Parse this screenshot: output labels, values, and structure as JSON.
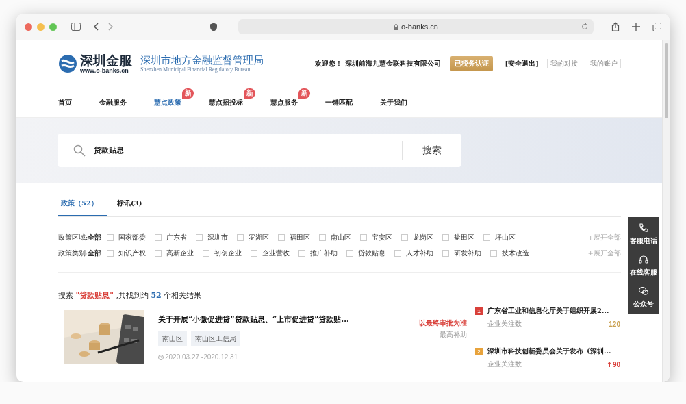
{
  "browser": {
    "url": "o-banks.cn"
  },
  "header": {
    "logo": {
      "name": "深圳金服",
      "site": "www.o-banks.cn"
    },
    "regulator": {
      "name": "深圳市地方金融监督管理局",
      "english": "Shenzhen Municipal Financial Regulatory Bureau"
    },
    "welcome": "欢迎您！ 深圳前海九慧金联科技有限公司",
    "certified": "已税务认证",
    "links": [
      "[安全退出]",
      "我的对接",
      "我的账户"
    ]
  },
  "nav": [
    {
      "label": "首页",
      "selected": false
    },
    {
      "label": "金融服务",
      "selected": false
    },
    {
      "label": "慧点政策",
      "selected": true,
      "badge": "新"
    },
    {
      "label": "慧点招投标",
      "selected": false,
      "badge": "新"
    },
    {
      "label": "慧点服务",
      "selected": false,
      "badge": "新"
    },
    {
      "label": "一键匹配",
      "selected": false
    },
    {
      "label": "关于我们",
      "selected": false
    }
  ],
  "search": {
    "value": "贷款贴息",
    "button": "搜索"
  },
  "tabs": [
    {
      "label": "政策（52）",
      "selected": true
    },
    {
      "label": "标讯(3)",
      "selected": false
    }
  ],
  "filters": [
    {
      "label": "政策区域:",
      "all": "全部",
      "expand": "+展开全部",
      "options": [
        {
          "label": "国家部委",
          "checked": false
        },
        {
          "label": "广东省",
          "checked": false
        },
        {
          "label": "深圳市",
          "checked": false
        },
        {
          "label": "罗湖区",
          "checked": false
        },
        {
          "label": "福田区",
          "checked": false
        },
        {
          "label": "南山区",
          "checked": false
        },
        {
          "label": "宝安区",
          "checked": false
        },
        {
          "label": "龙岗区",
          "checked": false
        },
        {
          "label": "盐田区",
          "checked": false
        },
        {
          "label": "坪山区",
          "checked": false
        }
      ]
    },
    {
      "label": "政策类别:",
      "all": "全部",
      "expand": "+展开全部",
      "options": [
        {
          "label": "知识产权",
          "checked": false
        },
        {
          "label": "高新企业",
          "checked": false
        },
        {
          "label": "初创企业",
          "checked": false
        },
        {
          "label": "企业营收",
          "checked": false
        },
        {
          "label": "推广补助",
          "checked": false
        },
        {
          "label": "贷款贴息",
          "checked": false
        },
        {
          "label": "人才补助",
          "checked": false
        },
        {
          "label": "研发补助",
          "checked": false
        },
        {
          "label": "技术改造",
          "checked": false
        }
      ]
    }
  ],
  "summary": {
    "prefix": "搜索",
    "query": "\"贷款贴息\"",
    "middle": ",共找到约",
    "count": "52",
    "suffix": "个相关结果"
  },
  "results": [
    {
      "kind": "picture",
      "title": "关于开展“小微促进贷”贷款贴息、“上市促进贷”贷款贴...",
      "tags": [
        "南山区",
        "南山区工信局"
      ],
      "date": "2020.03.27 -2020.12.31",
      "amount": "以最终审批为准",
      "amount_label": "最高补助"
    }
  ],
  "hot": [
    {
      "rank": "1",
      "color": "#d9403a",
      "title": "广东省工业和信息化厅关于组织开展2...",
      "meta": "企业关注数",
      "count": "120",
      "kind": "plain"
    },
    {
      "rank": "2",
      "color": "#e8a33c",
      "title": "深圳市科技创新委员会关于发布《深圳...",
      "meta": "企业关注数",
      "count": "90",
      "kind": "rising"
    }
  ],
  "side_tools": [
    {
      "kind": "phone",
      "label": "客服电话"
    },
    {
      "kind": "headset",
      "label": "在线客服"
    },
    {
      "kind": "wechat",
      "label": "公众号"
    }
  ]
}
